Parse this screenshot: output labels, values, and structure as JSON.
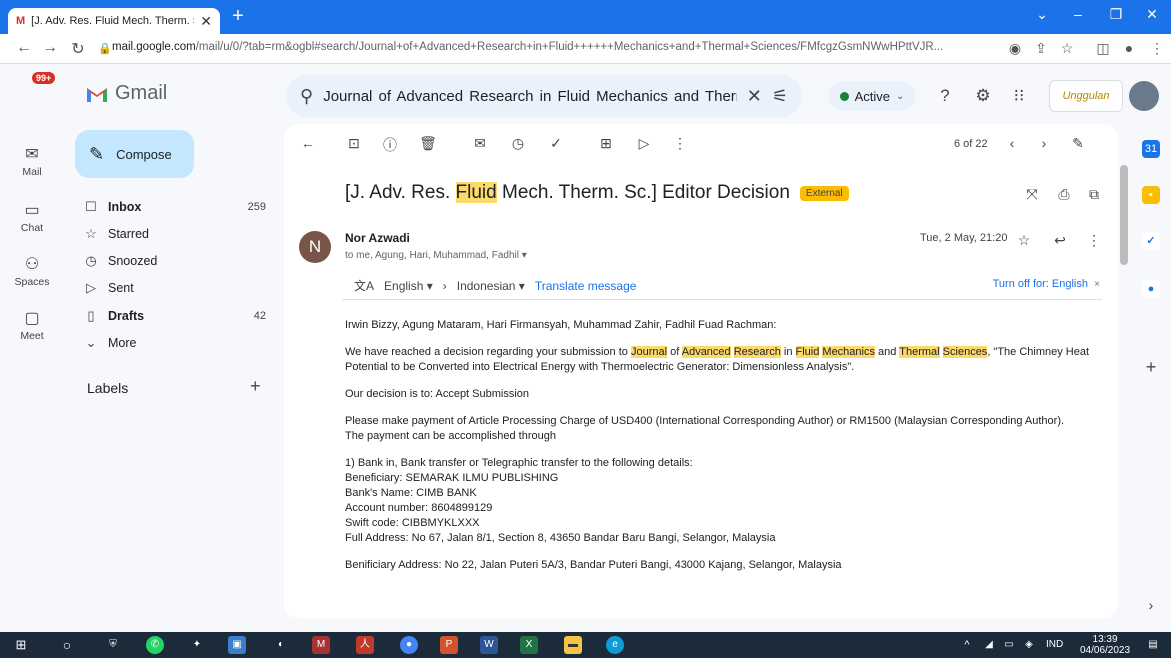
{
  "browser": {
    "tab_title": "[J. Adv. Res. Fluid Mech. Therm. S",
    "tab_close": "✕",
    "new_tab": "+",
    "url_host": "mail.google.com",
    "url_path": "/mail/u/0/?tab=rm&ogbl#search/Journal+of+Advanced+Research+in+Fluid++++++Mechanics+and+Thermal+Sciences/FMfcgzGsmNWwHPttVJR..."
  },
  "gmail": {
    "app_name": "Gmail",
    "search_query": "Journal of Advanced Research in Fluid     Mechanics and Therm",
    "status": "Active",
    "brand_text": "Unggulan",
    "rail": {
      "mail_label": "Mail",
      "mail_badge": "99+",
      "chat_label": "Chat",
      "spaces_label": "Spaces",
      "meet_label": "Meet"
    },
    "compose_label": "Compose",
    "nav": [
      {
        "label": "Inbox",
        "count": "259",
        "bold": true
      },
      {
        "label": "Starred",
        "count": "",
        "bold": false
      },
      {
        "label": "Snoozed",
        "count": "",
        "bold": false
      },
      {
        "label": "Sent",
        "count": "",
        "bold": false
      },
      {
        "label": "Drafts",
        "count": "42",
        "bold": true
      },
      {
        "label": "More",
        "count": "",
        "bold": false
      }
    ],
    "labels_heading": "Labels"
  },
  "message": {
    "page_info": "6 of 22",
    "subject_pre": "[J. Adv. Res. ",
    "subject_hl": "Fluid",
    "subject_post": " Mech. Therm. Sc.] Editor Decision",
    "external_badge": "External",
    "sender_initial": "N",
    "sender_name": "Nor Azwadi",
    "recipients": "to me, Agung, Hari, Muhammad, Fadhil ▾",
    "date": "Tue, 2 May, 21:20",
    "translate": {
      "from": "English ▾",
      "to": "Indonesian ▾",
      "action": "Translate message",
      "turn_off": "Turn off for: English"
    },
    "body": {
      "greeting": "Irwin Bizzy, Agung Mataram, Hari Firmansyah, Muhammad Zahir, Fadhil Fuad Rachman:",
      "p1_a": "We have reached a decision regarding your submission to ",
      "p1_journal": "Journal",
      "p1_of": " of ",
      "p1_advanced": "Advanced",
      "p1_research": "Research",
      "p1_in": " in ",
      "p1_fluid": "Fluid",
      "p1_mechanics": "Mechanics",
      "p1_and": " and ",
      "p1_thermal": "Thermal",
      "p1_sciences": "Sciences",
      "p1_rest": ", \"The Chimney Heat Potential to be Converted into Electrical Energy with Thermoelectric Generator: Dimensionless Analysis\".",
      "decision": "Our decision is to: Accept Submission",
      "payment1": "Please make payment of Article Processing Charge of USD400 (International Corresponding Author) or RM1500 (Malaysian Corresponding Author).",
      "payment2": "The payment can be accomplished through",
      "bank_intro": "1) Bank in, Bank transfer or Telegraphic transfer to the following details:",
      "beneficiary": "Beneficiary: SEMARAK ILMU PUBLISHING",
      "bank_name": "Bank's Name: CIMB BANK",
      "account": "Account number: 8604899129",
      "swift": "Swift code: CIBBMYKLXXX",
      "full_address": "Full Address: No 67, Jalan 8/1, Section 8, 43650 Bandar Baru Bangi, Selangor, Malaysia",
      "benif_address": "Benificiary Address: No 22, Jalan Puteri 5A/3, Bandar Puteri Bangi, 43000 Kajang, Selangor, Malaysia"
    }
  },
  "taskbar": {
    "lang": "IND",
    "time": "13:39",
    "date": "04/06/2023"
  }
}
